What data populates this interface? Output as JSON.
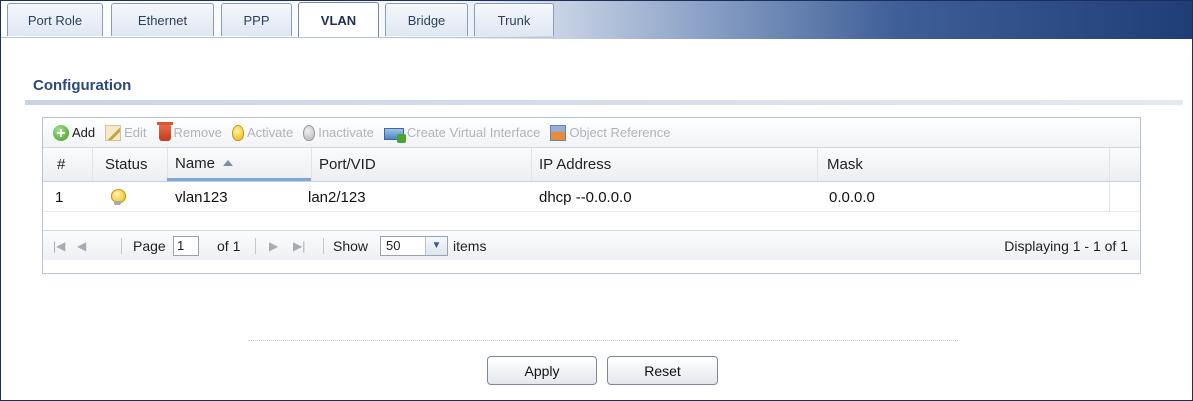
{
  "tabs": [
    {
      "label": "Port Role",
      "active": false
    },
    {
      "label": "Ethernet",
      "active": false
    },
    {
      "label": "PPP",
      "active": false
    },
    {
      "label": "VLAN",
      "active": true
    },
    {
      "label": "Bridge",
      "active": false
    },
    {
      "label": "Trunk",
      "active": false
    }
  ],
  "section": {
    "title": "Configuration"
  },
  "toolbar": {
    "add": "Add",
    "edit": "Edit",
    "remove": "Remove",
    "activate": "Activate",
    "inactivate": "Inactivate",
    "create_virtual_interface": "Create Virtual Interface",
    "object_reference": "Object Reference"
  },
  "table": {
    "columns": [
      "#",
      "Status",
      "Name",
      "Port/VID",
      "IP Address",
      "Mask"
    ],
    "sorted_column": "Name",
    "rows": [
      {
        "index": "1",
        "status_icon": "lightbulb-on-icon",
        "name": "vlan123",
        "port_vid": "lan2/123",
        "ip_address": "dhcp --0.0.0.0",
        "mask": "0.0.0.0"
      }
    ]
  },
  "pager": {
    "page_label": "Page",
    "page_value": "1",
    "of_label": "of 1",
    "show_label": "Show",
    "show_value": "50",
    "items_label": "items",
    "displaying": "Displaying 1 - 1 of 1"
  },
  "buttons": {
    "apply": "Apply",
    "reset": "Reset"
  },
  "colors": {
    "section_title": "#2a4a7e",
    "tab_bar_dark": "#1f3d76",
    "sort_indicator": "#7ea6d6"
  }
}
